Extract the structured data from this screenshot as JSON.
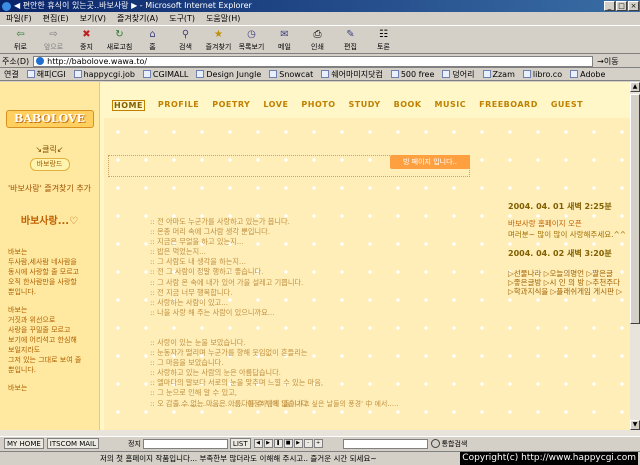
{
  "window": {
    "title": "◀ 편안한 휴식이 있는곳..바보사랑 ▶ - Microsoft Internet Explorer"
  },
  "menu": [
    "파일(F)",
    "편집(E)",
    "보기(V)",
    "즐겨찾기(A)",
    "도구(T)",
    "도움말(H)"
  ],
  "toolbar": [
    {
      "label": "뒤로",
      "icon": "back-arrow-icon",
      "glyph": "⇦"
    },
    {
      "label": "앞으로",
      "icon": "forward-arrow-icon",
      "glyph": "⇨"
    },
    {
      "label": "중지",
      "icon": "stop-icon",
      "glyph": "✖"
    },
    {
      "label": "새로고침",
      "icon": "refresh-icon",
      "glyph": "↻"
    },
    {
      "label": "홈",
      "icon": "home-icon",
      "glyph": "⌂"
    },
    {
      "label": "검색",
      "icon": "search-icon",
      "glyph": "⚲"
    },
    {
      "label": "즐겨찾기",
      "icon": "favorites-icon",
      "glyph": "★"
    },
    {
      "label": "목록보기",
      "icon": "history-icon",
      "glyph": "◷"
    },
    {
      "label": "메일",
      "icon": "mail-icon",
      "glyph": "✉"
    },
    {
      "label": "인쇄",
      "icon": "print-icon",
      "glyph": "⎙"
    },
    {
      "label": "편집",
      "icon": "edit-icon",
      "glyph": "✎"
    },
    {
      "label": "토론",
      "icon": "discuss-icon",
      "glyph": "☷"
    }
  ],
  "address": {
    "label": "주소(D)",
    "url": "http://babolove.wawa.to/",
    "go": "이동"
  },
  "links": {
    "label": "연결",
    "items": [
      "해피CGI",
      "happycgi.job",
      "CGIMALL",
      "Design Jungle",
      "Snowcat",
      "쉐어마미지닷컴",
      "500 free",
      "덩어리",
      "Zzam",
      "libro.co",
      "Adobe"
    ]
  },
  "page": {
    "logo": "BABOLOVE",
    "click_me": "↘클릭↙",
    "hp_button": "바보랑드",
    "add_favorite": "'바보사랑' 즐겨찾기 추가",
    "name": "바보사랑...♡",
    "left_text": [
      "바보는",
      "두사람,세사람 네사람을",
      "동시에 사랑할 줄 모르고",
      "오직 한사람만을 사랑할",
      "뿐입니다.",
      "",
      "바보는",
      "거짓과 위선으로",
      "사랑을 꾸밀줄 모르고",
      "보기에 어리석고 한심해",
      "보일지라도",
      "그저 있는 그대로 보여 줄",
      "뿐입니다.",
      "",
      "바보는"
    ],
    "nav": [
      "HOME",
      "PROFILE",
      "POETRY",
      "LOVE",
      "PHOTO",
      "STUDY",
      "BOOK",
      "MUSIC",
      "FREEBOARD",
      "GUEST"
    ],
    "bubble": "빙 페이지 입니다..",
    "poem1": [
      ":: 전 아마도 누군가를 사랑하고 있는가 봅니다.",
      ":: 온종 머리 속에 그사람 생각 뿐입니다.",
      ":: 지금은 무얼을 하고 있는지...",
      ":: 밥은 먹었는지...",
      ":: 그 사람도 내 생각을 하는지...",
      ":: 전 그 사람이 정말 행하고 좋습니다.",
      ":: 그 사람 온 속에 내가 있어 가을 설레고 기쁩니다.",
      ":: 전 지금 너무 행복합니다.",
      ":: 사랑하는 사람이 있고...",
      ":: 나을 사랑 해 주는 사람이 있으니까요..."
    ],
    "poem2": [
      ":: 사랑이 있는 눈을 보았습니다.",
      ":: 눈동자가 떨리며 누군가를 향해 웃임없이 흔들리는",
      ":: 그 마음을 보았습니다.",
      ":: 사랑하고 있는 사람의 눈은 아름답습니다.",
      ":: 엘마다의 말보다 서로의 눈을 맞추며 느낄 수 있는 마음,",
      ":: 그 눈으로 인해 알 수 있고,",
      ":: 오 감출 수 없는 마음은 아름다를 수 밖에 없습니다."
    ],
    "quote": "................................이정하님의 '들이가고 싶은 날들의 풍경' 中 에서.....",
    "entries": [
      {
        "date": "2004. 04. 01  새벽 2:25분",
        "title": "바보사랑 홈페이지 오픈",
        "body": "며러분~ 많이 많이 사랑해주세요.^^"
      },
      {
        "date": "2004. 04. 02  새벽 3:20분"
      }
    ],
    "side_links": [
      "▷선물나라 ▷오늘의명언 ▷짤은글",
      "▷좋은글방 ▷시 인 의 방 ▷추천주다",
      "▷학과지식을 ▷플래쉬게임  게시판 ▷"
    ]
  },
  "taskbar": {
    "my_home": "MY HOME",
    "itscom": "ITSCOM MAIL",
    "stop_label": "정지",
    "list": "LIST",
    "search_btn": "통합검색"
  },
  "status": {
    "text": "저의 첫 홈페이지 작품입니다... 부족한부 많더라도 이해해 주시고.. 즐거운 시간 되세요~",
    "copyright": "Copyright(c) http://www.happycgi.com"
  }
}
